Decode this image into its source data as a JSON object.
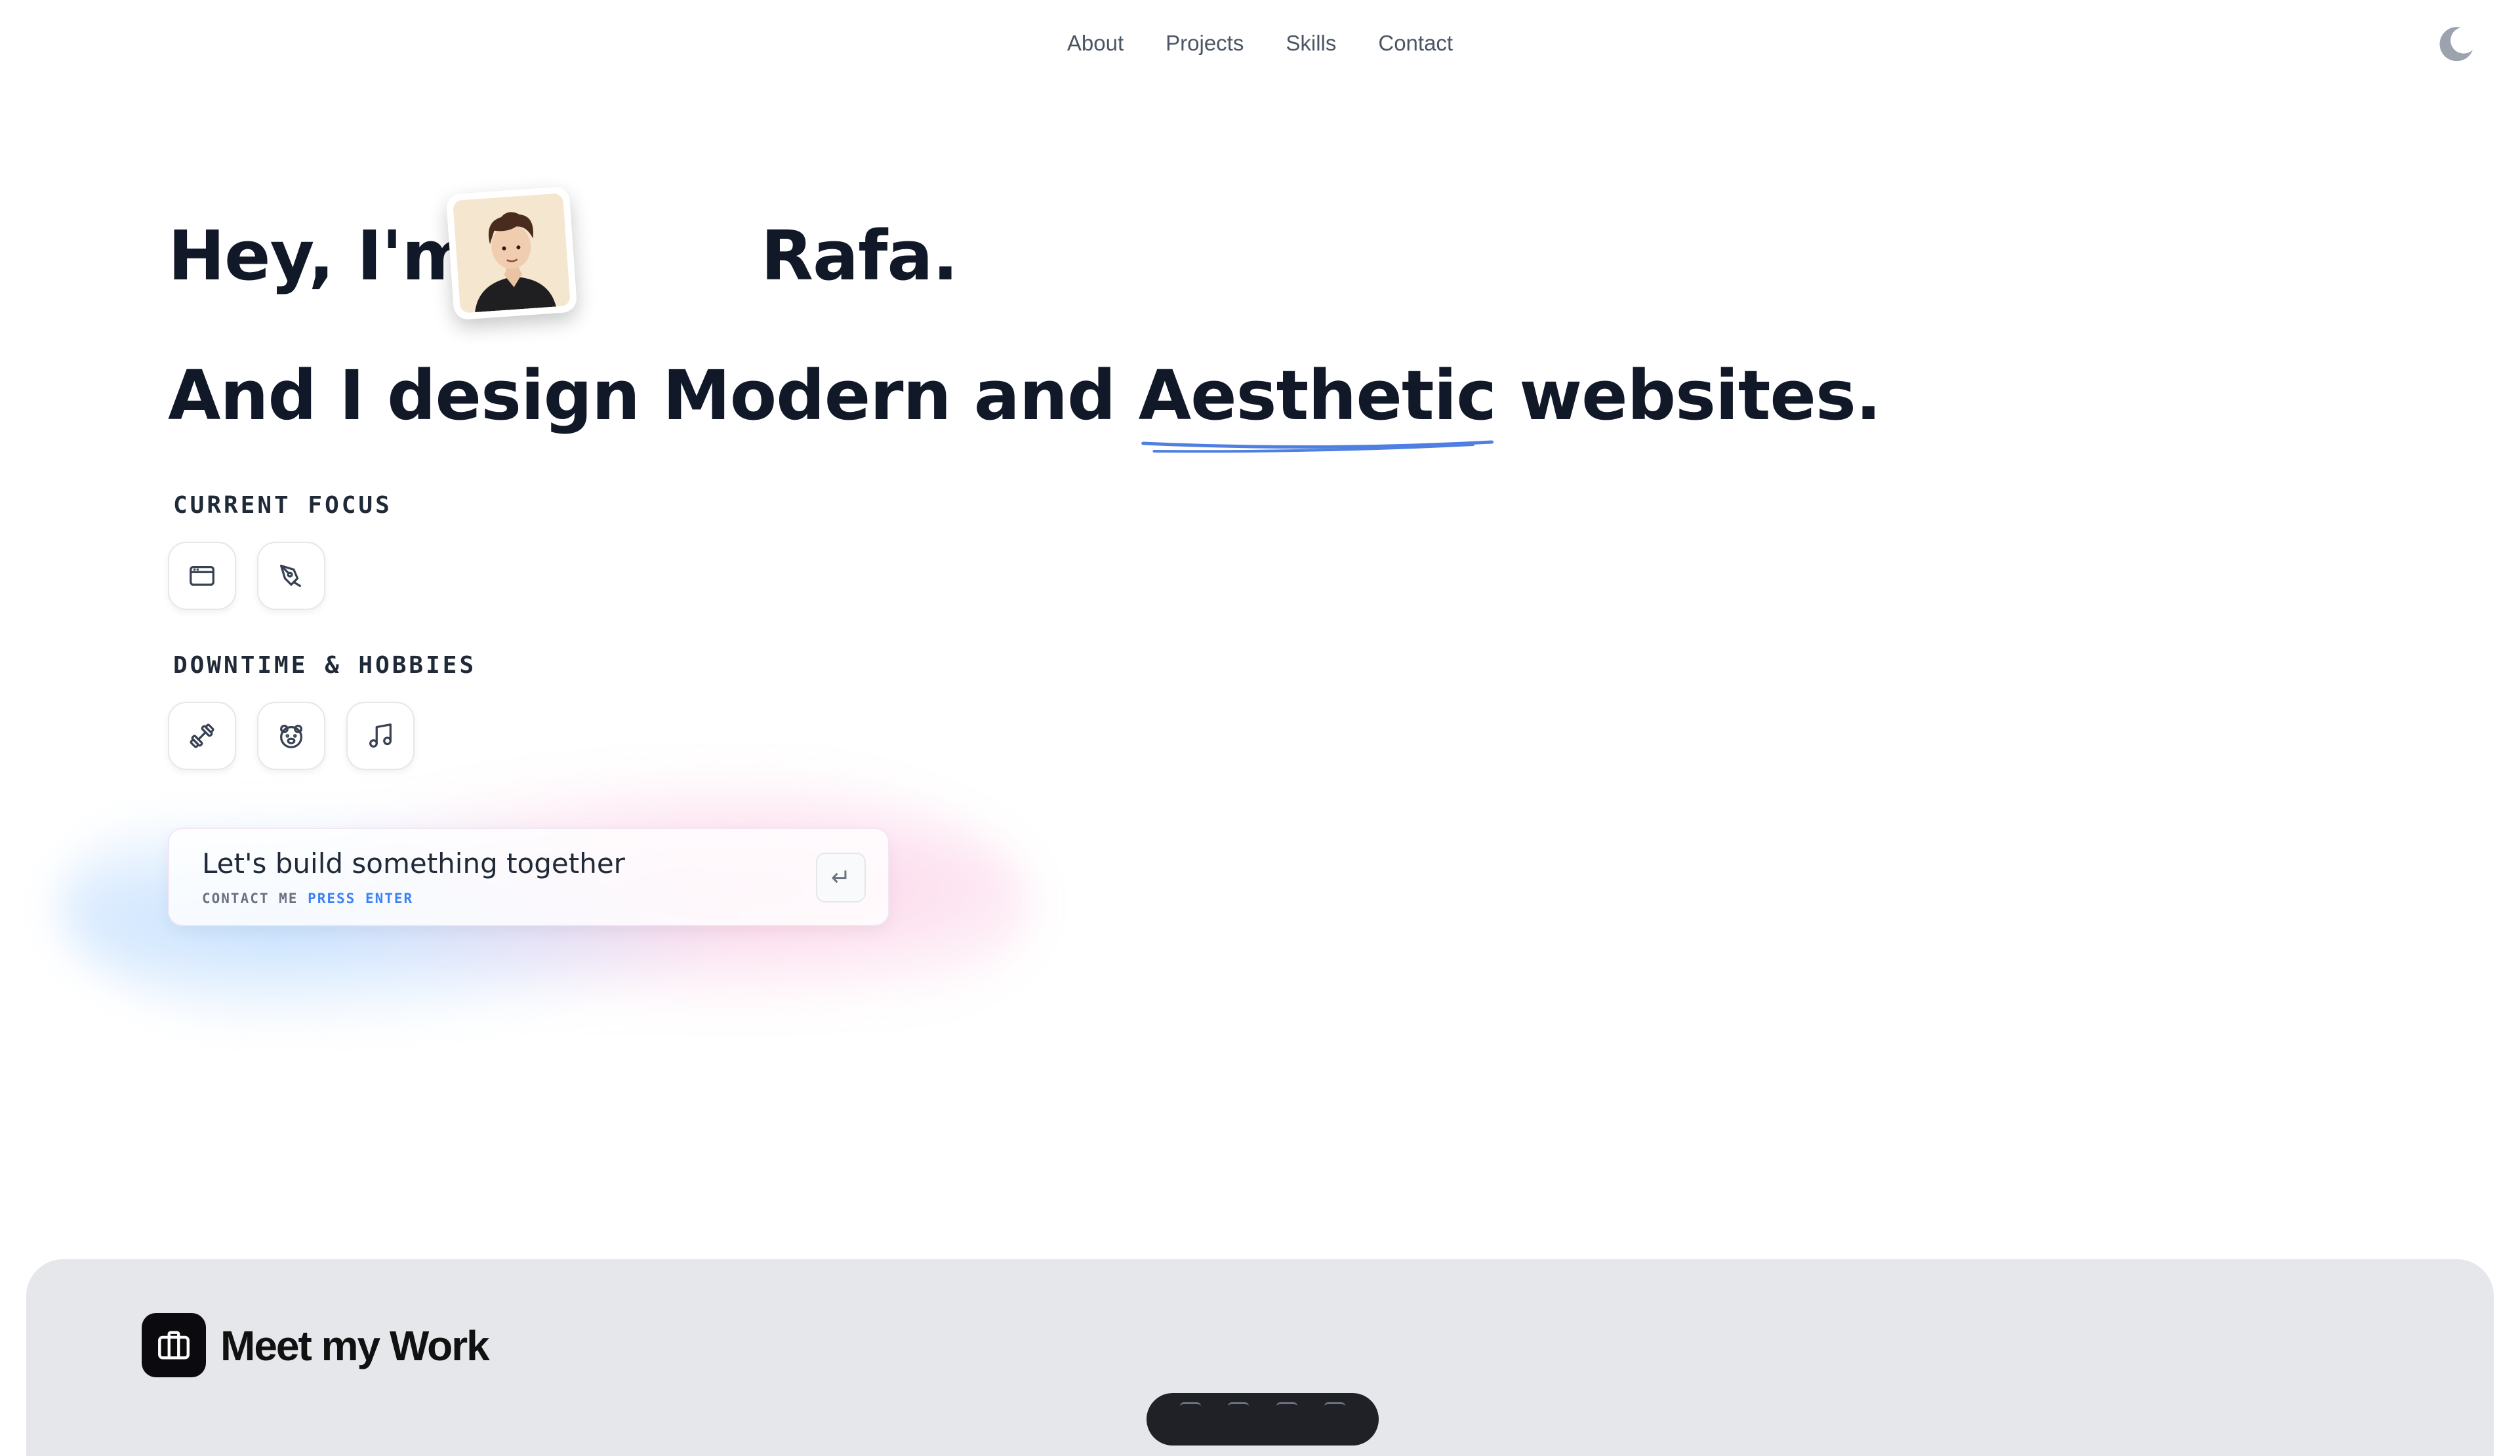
{
  "nav": {
    "items": [
      "About",
      "Projects",
      "Skills",
      "Contact"
    ]
  },
  "theme_toggle": {
    "icon": "moon-icon"
  },
  "hero": {
    "greeting_start": "Hey, I'm",
    "name": "Rafa.",
    "tagline_start": "And I design Modern and ",
    "tagline_highlight": "Aesthetic",
    "tagline_end": " websites."
  },
  "current_focus": {
    "label": "CURRENT FOCUS",
    "icons": [
      "browser-window-icon",
      "pen-tool-icon"
    ]
  },
  "hobbies": {
    "label": "DOWNTIME & HOBBIES",
    "icons": [
      "dumbbell-icon",
      "bear-face-icon",
      "music-note-icon"
    ]
  },
  "cta": {
    "title": "Let's build something together",
    "sub_label": "CONTACT ME",
    "sub_accent": "PRESS ENTER",
    "key_glyph": "↵"
  },
  "work": {
    "title": "Meet my Work",
    "icon": "briefcase-icon"
  },
  "colors": {
    "accent": "#3b82f6",
    "underline": "#4f7fe0",
    "text": "#111827",
    "section_bg": "#e5e7eb"
  }
}
